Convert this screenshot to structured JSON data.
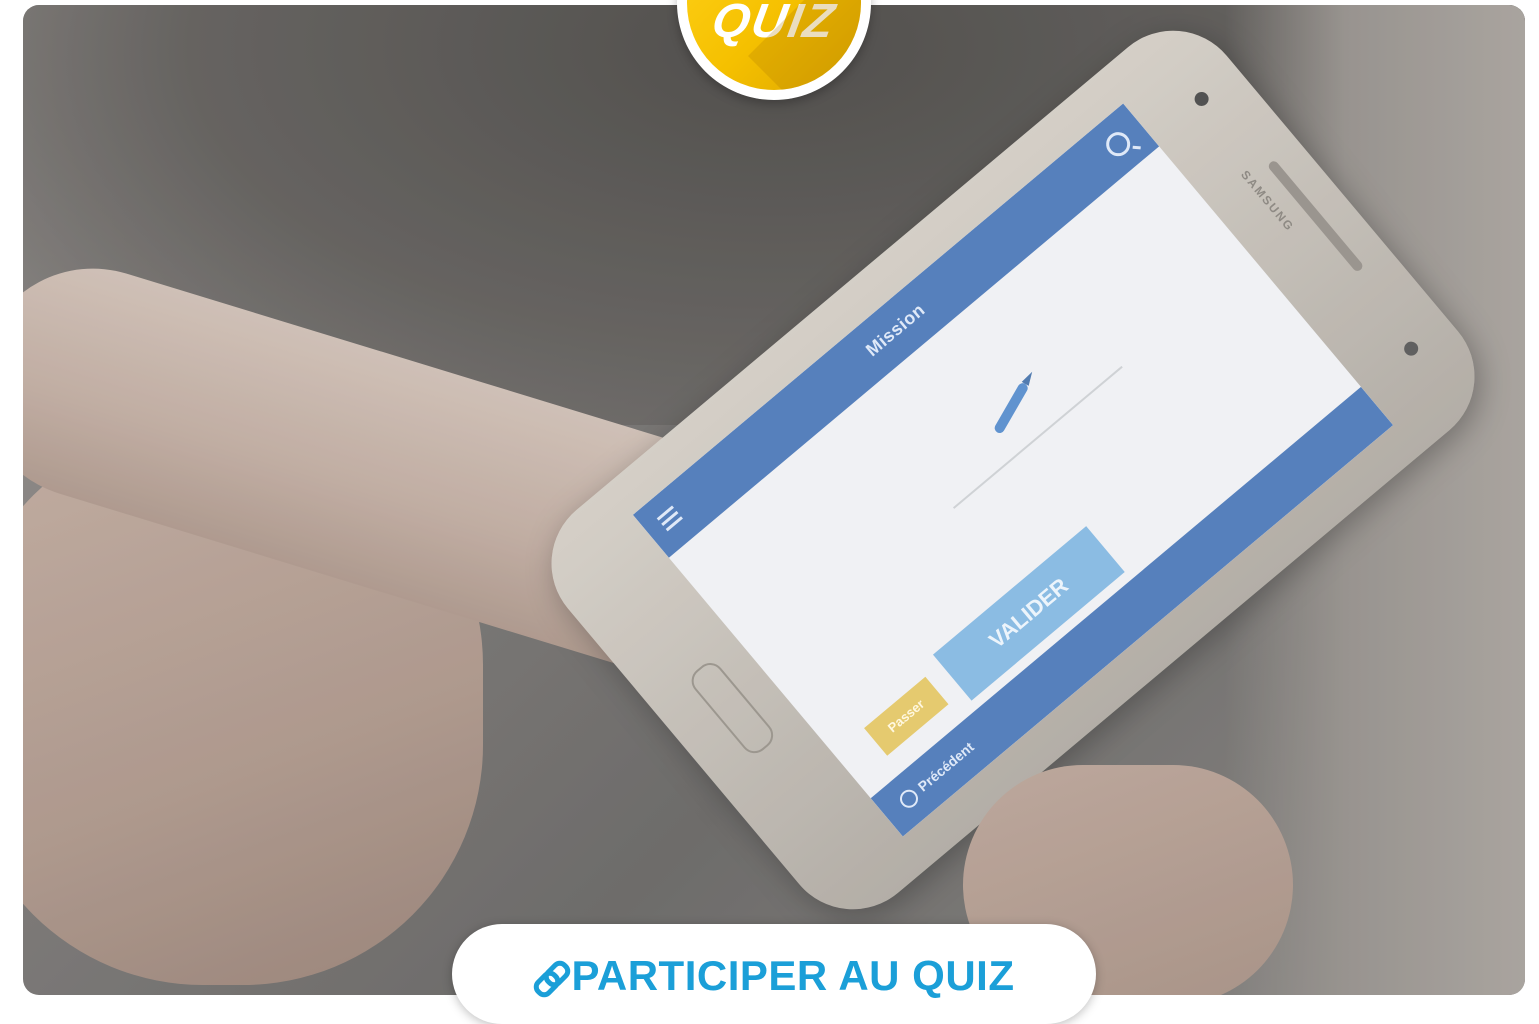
{
  "badge": {
    "label": "QUIZ"
  },
  "phone_screen": {
    "title": "Mission",
    "prev_label": "Précédent",
    "skip_label": "Passer",
    "validate_label": "VALIDER",
    "brand": "SAMSUNG"
  },
  "cta": {
    "label": "PARTICIPER AU QUIZ",
    "icon": "link-icon"
  },
  "colors": {
    "cta_text": "#1b9fd8",
    "badge_yellow": "#f5c000",
    "app_blue": "#3f6fb3"
  }
}
